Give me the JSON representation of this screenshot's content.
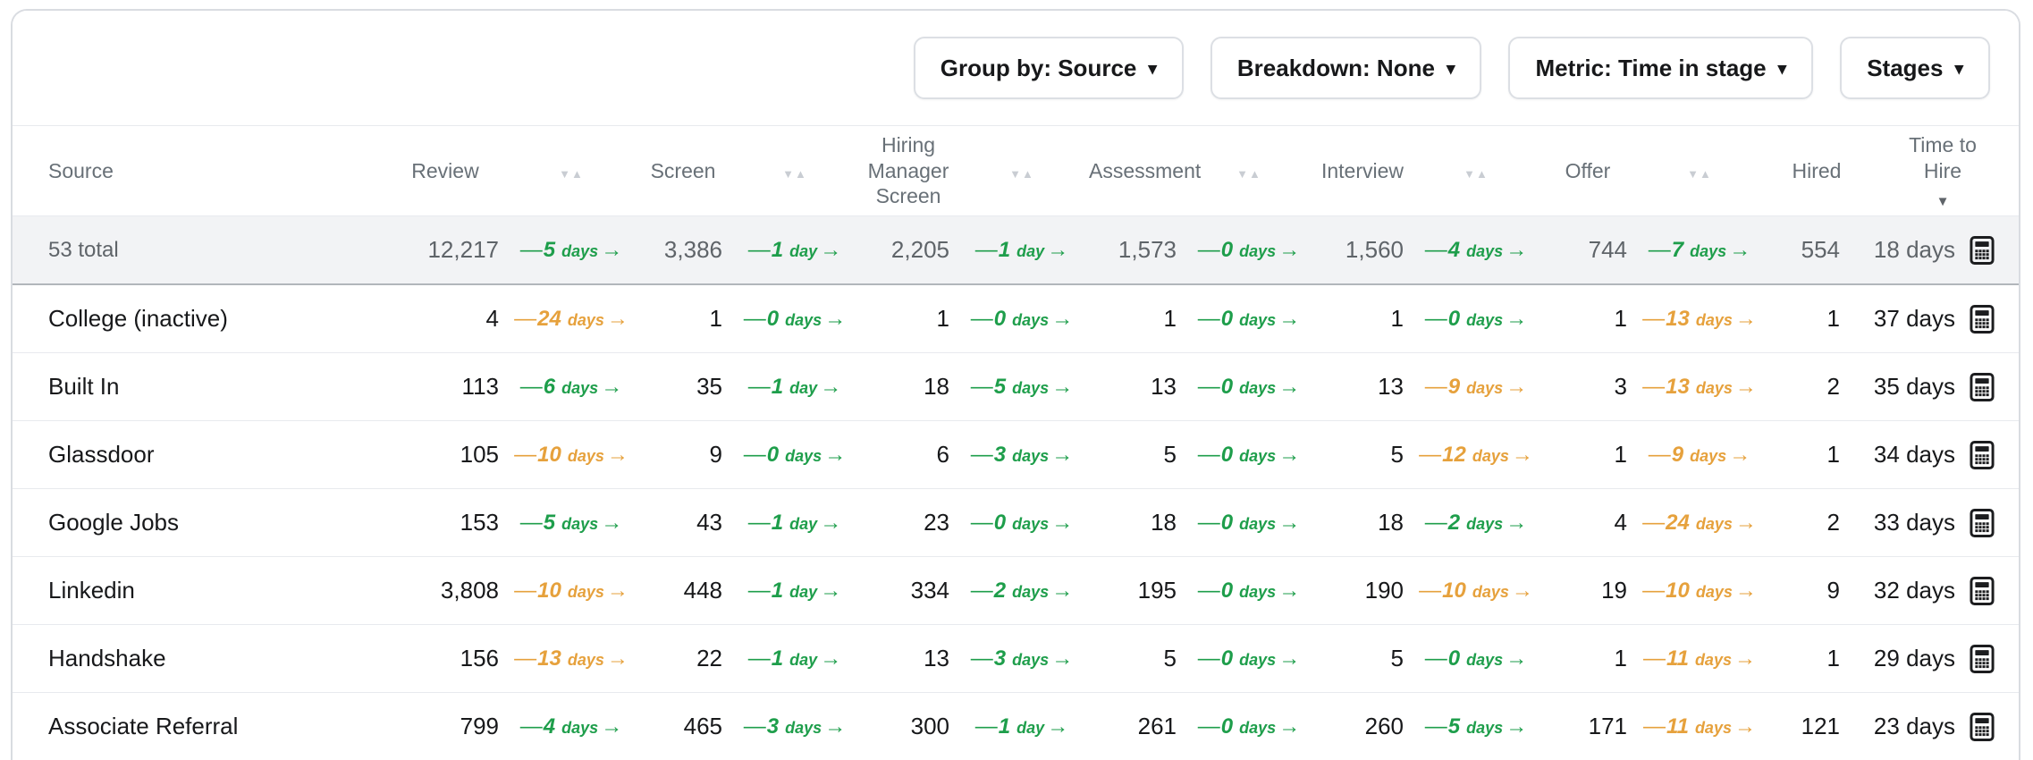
{
  "colors": {
    "green": "#1E9E4B",
    "orange": "#E6A13C"
  },
  "glyphs": {
    "dash": "—",
    "arrow": "→",
    "sort_desc": "▼",
    "sort_asc": "▲",
    "caret": "▾"
  },
  "toolbar": {
    "buttons": [
      {
        "label": "Group by: Source"
      },
      {
        "label": "Breakdown: None"
      },
      {
        "label": "Metric: Time in stage"
      },
      {
        "label": "Stages"
      }
    ]
  },
  "header": {
    "source": "Source",
    "stages": [
      "Review",
      "Screen",
      "Hiring Manager Screen",
      "Assessment",
      "Interview",
      "Offer"
    ],
    "hired": "Hired",
    "time_to_hire": "Time to Hire"
  },
  "table": {
    "total": {
      "label": "53 total",
      "counts": [
        "12,217",
        "3,386",
        "2,205",
        "1,573",
        "1,560",
        "744",
        "554"
      ],
      "transitions": [
        {
          "v": "5",
          "u": "days",
          "c": "green"
        },
        {
          "v": "1",
          "u": "day",
          "c": "green"
        },
        {
          "v": "1",
          "u": "day",
          "c": "green"
        },
        {
          "v": "0",
          "u": "days",
          "c": "green"
        },
        {
          "v": "4",
          "u": "days",
          "c": "green"
        },
        {
          "v": "7",
          "u": "days",
          "c": "green"
        }
      ],
      "time_to_hire": "18 days"
    },
    "rows": [
      {
        "source": "College (inactive)",
        "counts": [
          "4",
          "1",
          "1",
          "1",
          "1",
          "1",
          "1"
        ],
        "transitions": [
          {
            "v": "24",
            "u": "days",
            "c": "orange"
          },
          {
            "v": "0",
            "u": "days",
            "c": "green"
          },
          {
            "v": "0",
            "u": "days",
            "c": "green"
          },
          {
            "v": "0",
            "u": "days",
            "c": "green"
          },
          {
            "v": "0",
            "u": "days",
            "c": "green"
          },
          {
            "v": "13",
            "u": "days",
            "c": "orange"
          }
        ],
        "time_to_hire": "37 days"
      },
      {
        "source": "Built In",
        "counts": [
          "113",
          "35",
          "18",
          "13",
          "13",
          "3",
          "2"
        ],
        "transitions": [
          {
            "v": "6",
            "u": "days",
            "c": "green"
          },
          {
            "v": "1",
            "u": "day",
            "c": "green"
          },
          {
            "v": "5",
            "u": "days",
            "c": "green"
          },
          {
            "v": "0",
            "u": "days",
            "c": "green"
          },
          {
            "v": "9",
            "u": "days",
            "c": "orange"
          },
          {
            "v": "13",
            "u": "days",
            "c": "orange"
          }
        ],
        "time_to_hire": "35 days"
      },
      {
        "source": "Glassdoor",
        "counts": [
          "105",
          "9",
          "6",
          "5",
          "5",
          "1",
          "1"
        ],
        "transitions": [
          {
            "v": "10",
            "u": "days",
            "c": "orange"
          },
          {
            "v": "0",
            "u": "days",
            "c": "green"
          },
          {
            "v": "3",
            "u": "days",
            "c": "green"
          },
          {
            "v": "0",
            "u": "days",
            "c": "green"
          },
          {
            "v": "12",
            "u": "days",
            "c": "orange"
          },
          {
            "v": "9",
            "u": "days",
            "c": "orange"
          }
        ],
        "time_to_hire": "34 days"
      },
      {
        "source": "Google Jobs",
        "counts": [
          "153",
          "43",
          "23",
          "18",
          "18",
          "4",
          "2"
        ],
        "transitions": [
          {
            "v": "5",
            "u": "days",
            "c": "green"
          },
          {
            "v": "1",
            "u": "day",
            "c": "green"
          },
          {
            "v": "0",
            "u": "days",
            "c": "green"
          },
          {
            "v": "0",
            "u": "days",
            "c": "green"
          },
          {
            "v": "2",
            "u": "days",
            "c": "green"
          },
          {
            "v": "24",
            "u": "days",
            "c": "orange"
          }
        ],
        "time_to_hire": "33 days"
      },
      {
        "source": "Linkedin",
        "counts": [
          "3,808",
          "448",
          "334",
          "195",
          "190",
          "19",
          "9"
        ],
        "transitions": [
          {
            "v": "10",
            "u": "days",
            "c": "orange"
          },
          {
            "v": "1",
            "u": "day",
            "c": "green"
          },
          {
            "v": "2",
            "u": "days",
            "c": "green"
          },
          {
            "v": "0",
            "u": "days",
            "c": "green"
          },
          {
            "v": "10",
            "u": "days",
            "c": "orange"
          },
          {
            "v": "10",
            "u": "days",
            "c": "orange"
          }
        ],
        "time_to_hire": "32 days"
      },
      {
        "source": "Handshake",
        "counts": [
          "156",
          "22",
          "13",
          "5",
          "5",
          "1",
          "1"
        ],
        "transitions": [
          {
            "v": "13",
            "u": "days",
            "c": "orange"
          },
          {
            "v": "1",
            "u": "day",
            "c": "green"
          },
          {
            "v": "3",
            "u": "days",
            "c": "green"
          },
          {
            "v": "0",
            "u": "days",
            "c": "green"
          },
          {
            "v": "0",
            "u": "days",
            "c": "green"
          },
          {
            "v": "11",
            "u": "days",
            "c": "orange"
          }
        ],
        "time_to_hire": "29 days"
      },
      {
        "source": "Associate Referral",
        "counts": [
          "799",
          "465",
          "300",
          "261",
          "260",
          "171",
          "121"
        ],
        "transitions": [
          {
            "v": "4",
            "u": "days",
            "c": "green"
          },
          {
            "v": "3",
            "u": "days",
            "c": "green"
          },
          {
            "v": "1",
            "u": "day",
            "c": "green"
          },
          {
            "v": "0",
            "u": "days",
            "c": "green"
          },
          {
            "v": "5",
            "u": "days",
            "c": "green"
          },
          {
            "v": "11",
            "u": "days",
            "c": "orange"
          }
        ],
        "time_to_hire": "23 days"
      }
    ]
  }
}
